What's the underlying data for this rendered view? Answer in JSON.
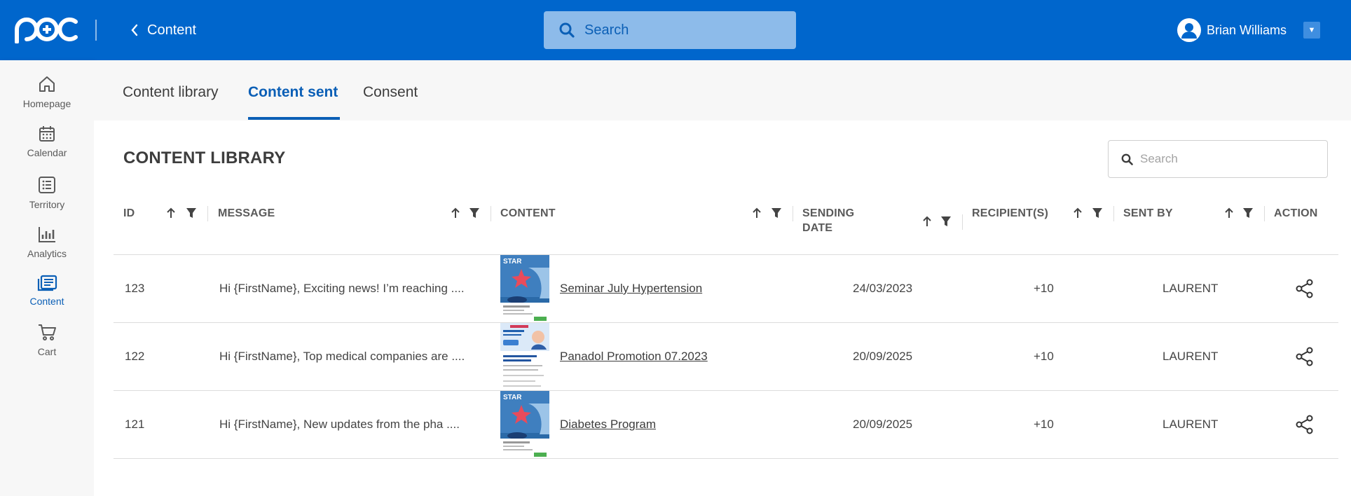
{
  "header": {
    "back_label": "Content",
    "search_placeholder": "Search",
    "user_name": "Brian Williams"
  },
  "sidebar": {
    "items": [
      {
        "label": "Homepage",
        "icon": "home-icon"
      },
      {
        "label": "Calendar",
        "icon": "calendar-icon"
      },
      {
        "label": "Territory",
        "icon": "list-icon"
      },
      {
        "label": "Analytics",
        "icon": "bar-chart-icon"
      },
      {
        "label": "Content",
        "icon": "content-icon",
        "active": true
      },
      {
        "label": "Cart",
        "icon": "cart-icon"
      }
    ]
  },
  "tabs": [
    {
      "label": "Content library"
    },
    {
      "label": "Content sent",
      "active": true
    },
    {
      "label": "Consent"
    }
  ],
  "main": {
    "title": "CONTENT LIBRARY",
    "search_placeholder": "Search"
  },
  "table": {
    "columns": [
      "ID",
      "MESSAGE",
      "CONTENT",
      "SENDING DATE",
      "RECIPIENT(S)",
      "SENT BY",
      "ACTION"
    ],
    "rows": [
      {
        "id": "123",
        "message": "Hi {FirstName}, Exciting news! I’m reaching ....",
        "content": "Seminar July Hypertension",
        "date": "24/03/2023",
        "recipients": "+10",
        "sent_by": "LAURENT",
        "thumb": "star-brochure"
      },
      {
        "id": "122",
        "message": "Hi {FirstName}, Top medical companies are ....",
        "content": "Panadol Promotion 07.2023",
        "date": "20/09/2025",
        "recipients": "+10",
        "sent_by": "LAURENT",
        "thumb": "panadol-brochure"
      },
      {
        "id": "121",
        "message": "Hi {FirstName}, New updates from the pha ....",
        "content": "Diabetes Program",
        "date": "20/09/2025",
        "recipients": "+10",
        "sent_by": "LAURENT",
        "thumb": "star-brochure"
      }
    ]
  },
  "colors": {
    "brand": "#0066cc",
    "accent": "#0b5fb6",
    "search_bg": "#8dbbea"
  }
}
